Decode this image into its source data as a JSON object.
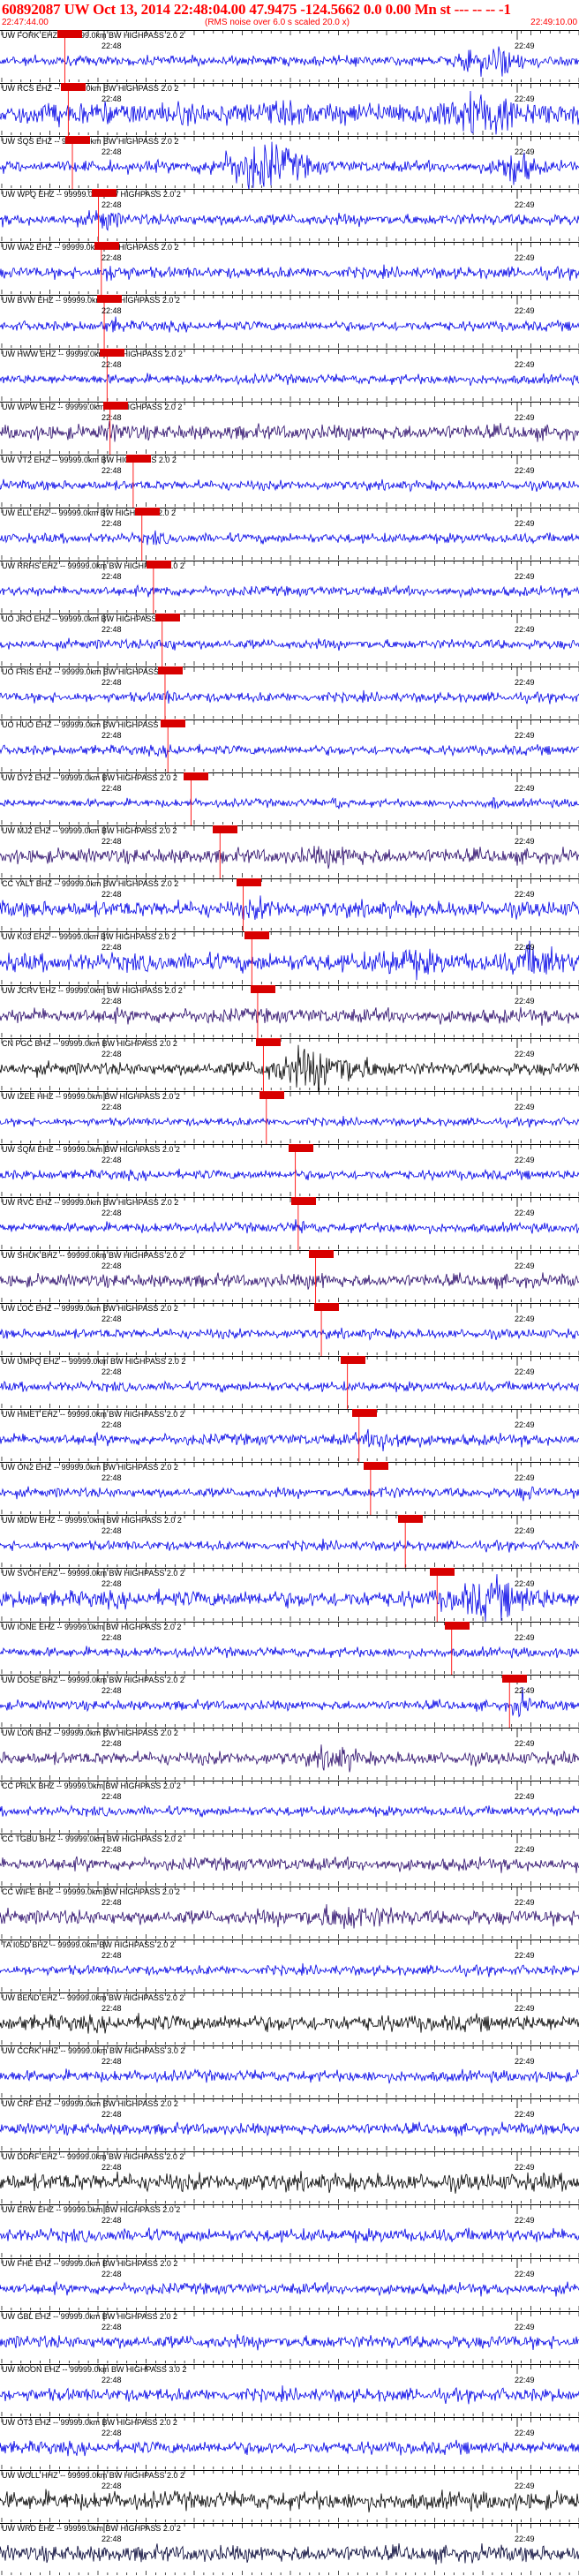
{
  "header": {
    "title": "60892087 UW Oct 13, 2014 22:48:04.00   47.9475 -124.5662  0.0 0.00 Mn st --- -- -- -1",
    "start_time": "22:47:44.00",
    "note": "(RMS noise over 6.0 s scaled 20.0 x)",
    "end_time": "22:49:10.00"
  },
  "tick_labels": {
    "left": "22:48",
    "right": "22:49"
  },
  "colors": {
    "header": "#ff0000",
    "pick_box": "#d80000",
    "pick_line": "#ff2020",
    "trace_blue": "#0000e6",
    "trace_purple": "#2a0a6a",
    "trace_black": "#000000",
    "trace_navy": "#000033"
  },
  "traces": [
    {
      "label": "UW FORK EHZ -- 99999.0km BW  HIGHPASS  2.0  2",
      "color": "blue",
      "amp": 0.3,
      "pick": 0.112,
      "bursts": [
        [
          0.85,
          0.05,
          3.5
        ]
      ]
    },
    {
      "label": "UW RCS EHZ -- 99999.0km BW  HIGHPASS  2.0  2",
      "color": "blue",
      "amp": 0.7,
      "pick": 0.118,
      "bursts": [
        [
          0.83,
          0.06,
          2.2
        ]
      ]
    },
    {
      "label": "UW SQS EHZ -- 99999.0km BW  HIGHPASS  2.0  2",
      "color": "blue",
      "amp": 0.35,
      "pick": 0.125,
      "bursts": [
        [
          0.45,
          0.07,
          4.5
        ],
        [
          0.89,
          0.03,
          3.5
        ]
      ]
    },
    {
      "label": "UW WPQ EHZ -- 99999.0km BW  HIGHPASS  2.0  2",
      "color": "blue",
      "amp": 0.35,
      "pick": 0.17,
      "bursts": [
        [
          0.18,
          0.02,
          2.5
        ]
      ]
    },
    {
      "label": "UW WA2 EHZ -- 99999.0km BW  HIGHPASS  2.0  2",
      "color": "blue",
      "amp": 0.35,
      "pick": 0.175,
      "bursts": [
        [
          0.2,
          0.02,
          2.0
        ]
      ]
    },
    {
      "label": "UW BVW EHZ -- 99999.0km BW  HIGHPASS  2.0  2",
      "color": "blue",
      "amp": 0.3,
      "pick": 0.18,
      "bursts": [
        [
          0.2,
          0.015,
          1.8
        ]
      ]
    },
    {
      "label": "UW HWW EHZ -- 99999.0km BW  HIGHPASS  2.0  2",
      "color": "blue",
      "amp": 0.3,
      "pick": 0.185,
      "bursts": []
    },
    {
      "label": "UW WPW EHZ -- 99999.0km BW  HIGHPASS  2.0  2",
      "color": "purple",
      "amp": 0.45,
      "pick": 0.19,
      "bursts": [
        [
          0.2,
          0.02,
          1.6
        ]
      ]
    },
    {
      "label": "UW VT2 EHZ -- 99999.0km BW  HIGHPASS  2.0  2",
      "color": "blue",
      "amp": 0.3,
      "pick": 0.23,
      "bursts": []
    },
    {
      "label": "UW ELL EHZ -- 99999.0km BW  HIGHPASS  2.0  2",
      "color": "blue",
      "amp": 0.3,
      "pick": 0.245,
      "bursts": [
        [
          0.27,
          0.015,
          1.6
        ]
      ]
    },
    {
      "label": "UW RRHS EHZ -- 99999.0km BW  HIGHPASS  2.0  2",
      "color": "blue",
      "amp": 0.3,
      "pick": 0.265,
      "bursts": [
        [
          0.28,
          0.015,
          1.5
        ]
      ]
    },
    {
      "label": "UO JRO EHZ -- 99999.0km BW  HIGHPASS  2.0  2",
      "color": "blue",
      "amp": 0.3,
      "pick": 0.28,
      "bursts": [
        [
          0.29,
          0.02,
          1.6
        ]
      ]
    },
    {
      "label": "UO FRIS EHZ -- 99999.0km BW  HIGHPASS  2.0  2",
      "color": "blue",
      "amp": 0.3,
      "pick": 0.285,
      "bursts": [
        [
          0.29,
          0.015,
          1.5
        ]
      ]
    },
    {
      "label": "UO HUO EHZ -- 99999.0km BW  HIGHPASS  2.0  2",
      "color": "blue",
      "amp": 0.3,
      "pick": 0.29,
      "bursts": [
        [
          0.3,
          0.015,
          1.5
        ]
      ]
    },
    {
      "label": "UW DY2 EHZ -- 99999.0km BW  HIGHPASS  2.0  2",
      "color": "blue",
      "amp": 0.25,
      "pick": 0.33,
      "bursts": [
        [
          0.58,
          0.01,
          2.0
        ],
        [
          0.85,
          0.01,
          2.0
        ]
      ]
    },
    {
      "label": "UW MJ2 EHZ -- 99999.0km BW  HIGHPASS  2.0  2",
      "color": "purple",
      "amp": 0.45,
      "pick": 0.38,
      "bursts": [
        [
          0.58,
          0.05,
          1.6
        ]
      ]
    },
    {
      "label": "CC YALT BHZ -- 99999.0km BW  HIGHPASS  2.0  2",
      "color": "blue",
      "amp": 0.5,
      "pick": 0.42,
      "bursts": [
        [
          0.45,
          0.03,
          1.5
        ]
      ]
    },
    {
      "label": "UW K03 EHZ -- 99999.0km BW  HIGHPASS  2.0  2",
      "color": "blue",
      "amp": 0.55,
      "pick": 0.435,
      "bursts": [
        [
          0.7,
          0.05,
          1.8
        ],
        [
          0.93,
          0.04,
          2.2
        ]
      ]
    },
    {
      "label": "UW JCRV EHZ -- 99999.0km BW  HIGHPASS  2.0  2",
      "color": "purple",
      "amp": 0.45,
      "pick": 0.445,
      "bursts": []
    },
    {
      "label": "CN PGC BHZ -- 99999.0km BW  HIGHPASS  2.0  2",
      "color": "black",
      "amp": 0.4,
      "pick": 0.455,
      "bursts": [
        [
          0.55,
          0.08,
          3.5
        ]
      ]
    },
    {
      "label": "UW IZEE HHZ -- 99999.0km BW  HIGHPASS  2.0  2",
      "color": "blue",
      "amp": 0.25,
      "pick": 0.46,
      "bursts": []
    },
    {
      "label": "UW SQM EHZ -- 99999.0km BW  HIGHPASS  2.0  2",
      "color": "blue",
      "amp": 0.3,
      "pick": 0.51,
      "bursts": []
    },
    {
      "label": "UW RVC EHZ -- 99999.0km BW  HIGHPASS  2.0  2",
      "color": "blue",
      "amp": 0.3,
      "pick": 0.515,
      "bursts": [
        [
          0.52,
          0.015,
          1.8
        ]
      ]
    },
    {
      "label": "UW SHUK BHZ -- 99999.0km BW  HIGHPASS  2.0  2",
      "color": "purple",
      "amp": 0.4,
      "pick": 0.545,
      "bursts": [
        [
          0.55,
          0.02,
          1.5
        ]
      ]
    },
    {
      "label": "UW LOC EHZ -- 99999.0km BW  HIGHPASS  2.0  2",
      "color": "blue",
      "amp": 0.3,
      "pick": 0.555,
      "bursts": []
    },
    {
      "label": "UW UMPQ EHZ -- 99999.0km BW  HIGHPASS  2.0  2",
      "color": "blue",
      "amp": 0.3,
      "pick": 0.6,
      "bursts": []
    },
    {
      "label": "UW HMET EHZ -- 99999.0km BW  HIGHPASS  2.0  2",
      "color": "blue",
      "amp": 0.35,
      "pick": 0.62,
      "bursts": [
        [
          0.67,
          0.04,
          2.2
        ]
      ]
    },
    {
      "label": "UW ON2 EHZ -- 99999.0km BW  HIGHPASS  2.0  2",
      "color": "blue",
      "amp": 0.3,
      "pick": 0.64,
      "bursts": [
        [
          0.67,
          0.015,
          1.8
        ],
        [
          0.91,
          0.015,
          1.8
        ]
      ]
    },
    {
      "label": "UW MDW EHZ -- 99999.0km BW  HIGHPASS  2.0  2",
      "color": "blue",
      "amp": 0.3,
      "pick": 0.7,
      "bursts": []
    },
    {
      "label": "UW SVOH EHZ -- 99999.0km BW  HIGHPASS  2.0  2",
      "color": "blue",
      "amp": 0.5,
      "pick": 0.755,
      "bursts": [
        [
          0.85,
          0.07,
          2.5
        ]
      ]
    },
    {
      "label": "UW IONE EHZ -- 99999.0km BW  HIGHPASS  2.0  2",
      "color": "blue",
      "amp": 0.3,
      "pick": 0.78,
      "bursts": []
    },
    {
      "label": "UW DOSE BHZ -- 99999.0km BW  HIGHPASS  2.0  2",
      "color": "blue",
      "amp": 0.3,
      "pick": 0.88,
      "bursts": [
        [
          0.9,
          0.015,
          3.0
        ]
      ]
    },
    {
      "label": "UW LON BHZ -- 99999.0km BW  HIGHPASS  2.0  2",
      "color": "purple",
      "amp": 0.4,
      "pick": null,
      "bursts": [
        [
          0.58,
          0.035,
          2.2
        ]
      ]
    },
    {
      "label": "CC PRLK BHZ -- 99999.0km BW  HIGHPASS  2.0  2",
      "color": "blue",
      "amp": 0.3,
      "pick": null,
      "bursts": []
    },
    {
      "label": "CC TGBU BHZ -- 99999.0km BW  HIGHPASS  2.0  2",
      "color": "purple",
      "amp": 0.4,
      "pick": null,
      "bursts": []
    },
    {
      "label": "CC WIFE BHZ -- 99999.0km BW  HIGHPASS  2.0  2",
      "color": "purple",
      "amp": 0.45,
      "pick": null,
      "bursts": [
        [
          0.6,
          0.07,
          2.0
        ]
      ]
    },
    {
      "label": "TA I05D BHZ -- 99999.0km BW  HIGHPASS  2.0  2",
      "color": "blue",
      "amp": 0.3,
      "pick": null,
      "bursts": []
    },
    {
      "label": "UW BEND EHZ -- 99999.0km BW  HIGHPASS  2.0  2",
      "color": "black",
      "amp": 0.5,
      "pick": null,
      "bursts": []
    },
    {
      "label": "UW CCRK HHZ -- 99999.0km BW  HIGHPASS  3.0  2",
      "color": "blue",
      "amp": 0.35,
      "pick": null,
      "bursts": []
    },
    {
      "label": "UW CRF EHZ -- 99999.0km BW  HIGHPASS  2.0  2",
      "color": "blue",
      "amp": 0.35,
      "pick": null,
      "bursts": []
    },
    {
      "label": "UW DDRF EHZ -- 99999.0km BW  HIGHPASS  2.0  2",
      "color": "black",
      "amp": 0.55,
      "pick": null,
      "bursts": []
    },
    {
      "label": "UW ERW EHZ -- 99999.0km BW  HIGHPASS  2.0  2",
      "color": "blue",
      "amp": 0.4,
      "pick": null,
      "bursts": []
    },
    {
      "label": "UW FHE EHZ -- 99999.0km BW  HIGHPASS  2.0  2",
      "color": "blue",
      "amp": 0.35,
      "pick": null,
      "bursts": []
    },
    {
      "label": "UW GBL EHZ -- 99999.0km BW  HIGHPASS  2.0  2",
      "color": "blue",
      "amp": 0.4,
      "pick": null,
      "bursts": []
    },
    {
      "label": "UW MOON EHZ -- 99999.0km BW  HIGHPASS  3.0  2",
      "color": "blue",
      "amp": 0.4,
      "pick": null,
      "bursts": []
    },
    {
      "label": "UW OT3 EHZ -- 99999.0km BW  HIGHPASS  2.0  2",
      "color": "blue",
      "amp": 0.4,
      "pick": null,
      "bursts": []
    },
    {
      "label": "UW WOLL HHZ -- 99999.0km BW  HIGHPASS  2.0  2",
      "color": "black",
      "amp": 0.55,
      "pick": null,
      "bursts": []
    },
    {
      "label": "UW WRD EHZ -- 99999.0km BW  HIGHPASS  2.0  2",
      "color": "navy",
      "amp": 0.5,
      "pick": null,
      "bursts": []
    }
  ]
}
